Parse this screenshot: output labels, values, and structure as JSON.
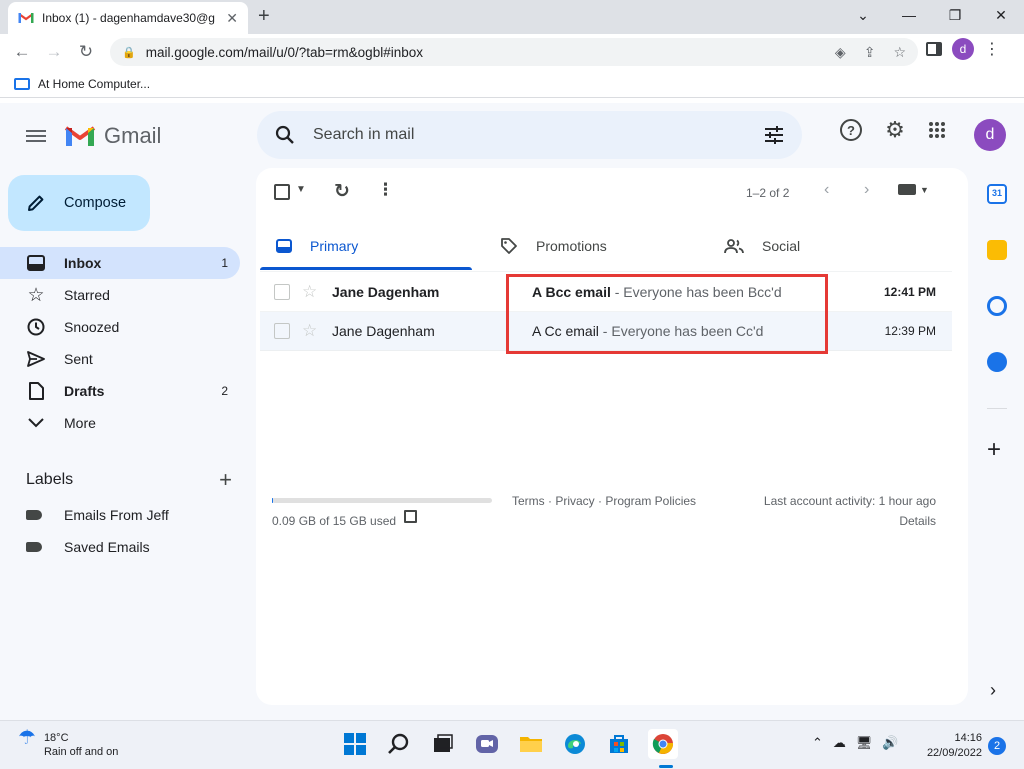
{
  "browser": {
    "tab_title": "Inbox (1) - dagenhamdave30@g",
    "url": "mail.google.com/mail/u/0/?tab=rm&ogbl#inbox",
    "profile_initial": "d",
    "bookmark_label": "At Home Computer..."
  },
  "gmail": {
    "wordmark": "Gmail",
    "search_placeholder": "Search in mail",
    "avatar_initial": "d",
    "compose_label": "Compose",
    "nav": [
      {
        "label": "Inbox",
        "count": "1",
        "icon": "inbox-icon"
      },
      {
        "label": "Starred",
        "count": "",
        "icon": "star-icon"
      },
      {
        "label": "Snoozed",
        "count": "",
        "icon": "clock-icon"
      },
      {
        "label": "Sent",
        "count": "",
        "icon": "send-icon"
      },
      {
        "label": "Drafts",
        "count": "2",
        "icon": "draft-icon"
      },
      {
        "label": "More",
        "count": "",
        "icon": "chevron-down-icon"
      }
    ],
    "labels_heading": "Labels",
    "labels": [
      "Emails From Jeff",
      "Saved Emails"
    ],
    "pager": "1–2 of 2",
    "tabs": [
      {
        "label": "Primary",
        "icon": "inbox-icon"
      },
      {
        "label": "Promotions",
        "icon": "tag-icon"
      },
      {
        "label": "Social",
        "icon": "people-icon"
      }
    ],
    "emails": [
      {
        "sender": "Jane Dagenham",
        "subject": "A Bcc email",
        "snippet": " - Everyone has been Bcc'd",
        "time": "12:41 PM",
        "unread": true
      },
      {
        "sender": "Jane Dagenham",
        "subject": "A Cc email",
        "snippet": " - Everyone has been Cc'd",
        "time": "12:39 PM",
        "unread": false
      }
    ],
    "footer": {
      "storage": "0.09 GB of 15 GB used",
      "storage_fraction": 0.006,
      "links": "Terms · Privacy · Program Policies",
      "activity": "Last account activity: 1 hour ago",
      "details": "Details"
    }
  },
  "taskbar": {
    "temp": "18°C",
    "weather": "Rain off and on",
    "time": "14:16",
    "date": "22/09/2022",
    "notifications": "2"
  },
  "colors": {
    "accent": "#0b57d0",
    "highlight_box": "#e53935",
    "compose_bg": "#c2e7ff",
    "active_nav": "#d3e3fd"
  }
}
